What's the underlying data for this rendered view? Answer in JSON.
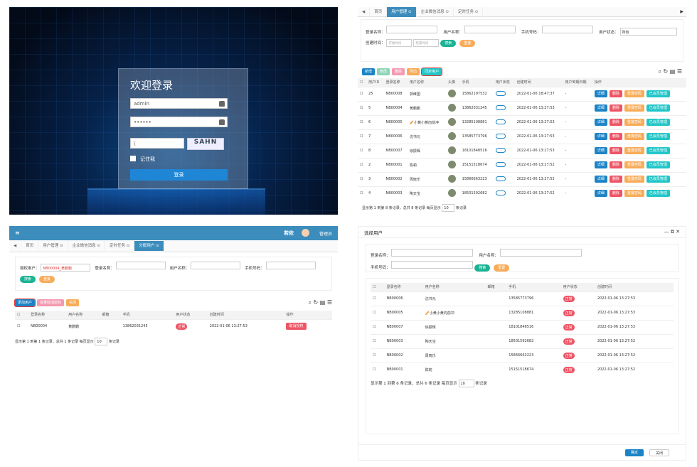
{
  "login": {
    "title": "欢迎登录",
    "username": "admin",
    "password": "••••••",
    "captcha_input": "\\",
    "captcha_text": "SAHN",
    "remember": "记住我",
    "submit": "登录"
  },
  "user_admin": {
    "tabs": [
      "首页",
      "用户管理 ⊙",
      "企业微信消息 ⊙",
      "定时任务 ⊙"
    ],
    "search": {
      "login_name": "登录名称：",
      "user_name": "用户名称：",
      "phone": "手机号码：",
      "status": "用户状态：",
      "status_value": "所有",
      "created": "创建时间：",
      "start": "开始时间",
      "end": "结束时间",
      "search_btn": "搜索",
      "reset_btn": "重置"
    },
    "toolbar": [
      "新增",
      "修改",
      "删除",
      "导出",
      "同步用户"
    ],
    "columns": [
      "用户ID",
      "登录名称",
      "用户名称",
      "头像",
      "手机",
      "用户状态",
      "创建时间",
      "用户到期日期",
      "操作"
    ],
    "rows": [
      [
        "25",
        "NB00008",
        "郭维国",
        "15862197532",
        "2022-01-06 18:47:37",
        "-"
      ],
      [
        "5",
        "NB00004",
        "黄鹏鹏",
        "13862031245",
        "2022-01-06 13:27:53",
        "-"
      ],
      [
        "6",
        "NB00005",
        "🥖小黄小黄向前冲",
        "13285108881",
        "2022-01-06 13:27:53",
        "-"
      ],
      [
        "7",
        "NB00006",
        "沈书元",
        "13585773796",
        "2022-01-06 13:27:53",
        "-"
      ],
      [
        "8",
        "NB00007",
        "徐振辉",
        "18101848516",
        "2022-01-06 13:27:53",
        "-"
      ],
      [
        "2",
        "NB00001",
        "陈莉",
        "15151518674",
        "2022-01-06 13:27:52",
        "-"
      ],
      [
        "3",
        "NB00002",
        "周晓乐",
        "15866663223",
        "2022-01-06 13:27:52",
        "-"
      ],
      [
        "4",
        "NB00003",
        "陶天宝",
        "18501592682",
        "2022-01-06 13:27:52",
        "-"
      ]
    ],
    "actions": [
      "详细",
      "删除",
      "重置密码",
      "已会员管理"
    ],
    "footer": "显示第 1 到第 8 条记录，总共 8 条记录  每页显示",
    "page_size": "10",
    "footer_suffix": "条记录"
  },
  "role_user": {
    "brand": "若依",
    "user": "管理员",
    "tabs": [
      "首页",
      "用户管理 ⊙",
      "企业微信消息 ⊙",
      "定时任务 ⊙",
      "分配用户 ⊙"
    ],
    "assign_label": "授权用户：",
    "assign_value": "NB00004_黄鹏鹏",
    "search": {
      "login_name": "登录名称：",
      "user_name": "用户名称：",
      "phone": "手机号码：",
      "search_btn": "搜索",
      "reset_btn": "重置"
    },
    "toolbar": [
      "添加用户",
      "批量取消授权",
      "关闭"
    ],
    "columns": [
      "登录名称",
      "用户名称",
      "邮箱",
      "手机",
      "用户状态",
      "创建时间",
      "操作"
    ],
    "rows": [
      [
        "NB00004",
        "黄鹏鹏",
        "",
        "13862031245",
        "正常",
        "2022-01-06 13:27:53",
        "取消授权"
      ]
    ],
    "footer": "显示第 1 到第 1 条记录，总共 1 条记录  每页显示",
    "page_size": "10",
    "footer_suffix": "条记录"
  },
  "select_user": {
    "title": "选择用户",
    "search": {
      "login_name": "登录名称：",
      "user_name": "用户名称：",
      "phone": "手机号码：",
      "search_btn": "搜索",
      "reset_btn": "重置"
    },
    "columns": [
      "登录名称",
      "用户名称",
      "邮箱",
      "手机",
      "用户状态",
      "创建时间"
    ],
    "rows": [
      [
        "NB00006",
        "沈书元",
        "",
        "13585773796",
        "正常",
        "2022-01-06 13:27:53"
      ],
      [
        "NB00005",
        "🥖小黄小黄向前冲",
        "",
        "13285108881",
        "正常",
        "2022-01-06 13:27:53"
      ],
      [
        "NB00007",
        "徐振辉",
        "",
        "18101848516",
        "正常",
        "2022-01-06 13:27:53"
      ],
      [
        "NB00003",
        "陶天宝",
        "",
        "18501592682",
        "正常",
        "2022-01-06 13:27:52"
      ],
      [
        "NB00002",
        "周晓乐",
        "",
        "15866663223",
        "正常",
        "2022-01-06 13:27:52"
      ],
      [
        "NB00001",
        "陈莉",
        "",
        "15151518674",
        "正常",
        "2022-01-06 13:27:52"
      ]
    ],
    "footer": "显示第 1 到第 6 条记录，总共 6 条记录  每页显示",
    "page_size": "10",
    "footer_suffix": "条记录",
    "confirm": "确定",
    "close": "关闭"
  },
  "colors": {
    "primary": "#3c8dbc",
    "blue": "#1c84c6",
    "green": "#1ab394",
    "red": "#ed5565",
    "orange": "#f8ac59"
  }
}
